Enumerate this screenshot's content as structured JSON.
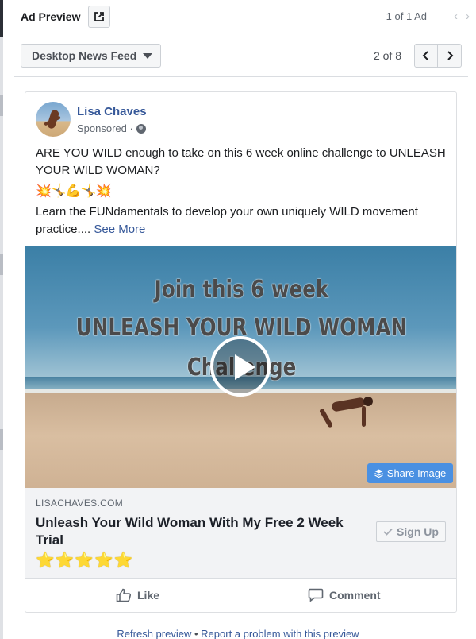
{
  "header": {
    "title": "Ad Preview",
    "ad_count": "1 of 1 Ad",
    "prev_icon": "chevron-left-icon",
    "next_icon": "chevron-right-icon",
    "external_icon": "external-link-icon"
  },
  "toolbar": {
    "placement": "Desktop News Feed",
    "pager": "2 of 8"
  },
  "post": {
    "author": "Lisa Chaves",
    "sponsored": "Sponsored ·",
    "text_line1": "ARE YOU WILD enough to take on this 6 week online challenge to UNLEASH YOUR WILD WOMAN?",
    "emoji_line": "💥🤸💪🤸💥",
    "text_line2": "Learn the FUNdamentals to develop your own uniquely WILD movement practice.... ",
    "see_more": "See More"
  },
  "media": {
    "overlay_line1": "Join this 6 week",
    "overlay_line2": "UNLEASH YOUR WILD WOMAN",
    "overlay_line3": "Challenge",
    "share_label": "Share Image"
  },
  "link": {
    "domain": "LISACHAVES.COM",
    "headline": "Unleash Your Wild Woman With My Free 2 Week Trial",
    "rating": 5,
    "rating_stars": "⭐⭐⭐⭐⭐",
    "cta": "Sign Up"
  },
  "actions": {
    "like": "Like",
    "comment": "Comment"
  },
  "footer": {
    "refresh": "Refresh preview",
    "separator": "•",
    "report": "Report a problem with this preview"
  },
  "colors": {
    "link_blue": "#365899",
    "share_button": "#4a90e2",
    "border": "#dddfe2"
  }
}
